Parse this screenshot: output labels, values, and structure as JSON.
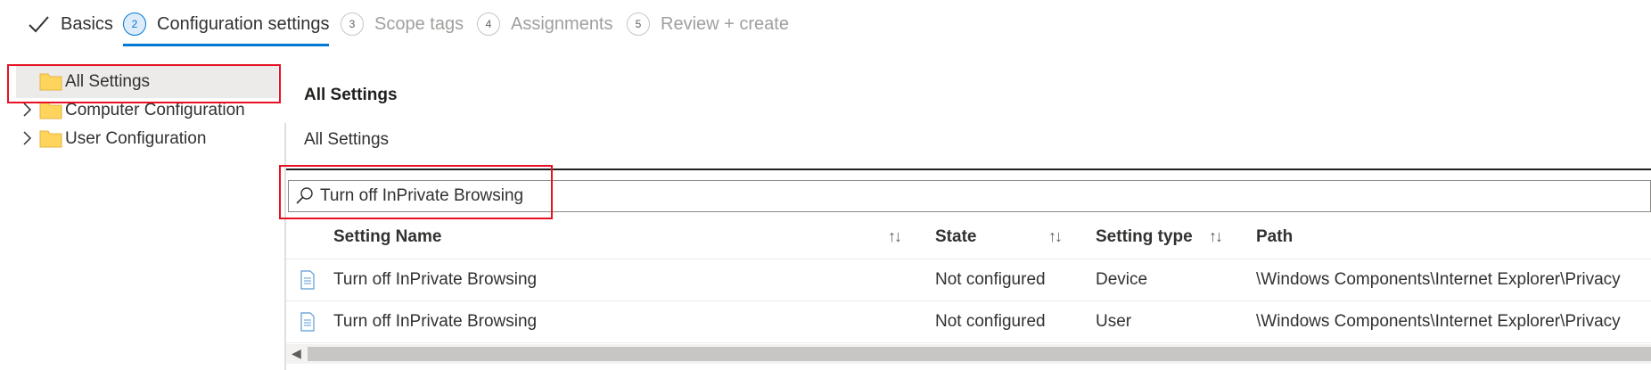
{
  "wizard": {
    "steps": [
      {
        "number": "",
        "label": "Basics",
        "state": "done"
      },
      {
        "number": "2",
        "label": "Configuration settings",
        "state": "active"
      },
      {
        "number": "3",
        "label": "Scope tags",
        "state": "pending"
      },
      {
        "number": "4",
        "label": "Assignments",
        "state": "pending"
      },
      {
        "number": "5",
        "label": "Review + create",
        "state": "pending"
      }
    ]
  },
  "tree": {
    "items": [
      {
        "label": "All Settings",
        "selected": true,
        "expandable": false
      },
      {
        "label": "Computer Configuration",
        "selected": false,
        "expandable": true
      },
      {
        "label": "User Configuration",
        "selected": false,
        "expandable": true
      }
    ]
  },
  "panel": {
    "title": "All Settings",
    "breadcrumb": "All Settings"
  },
  "search": {
    "value": "Turn off InPrivate Browsing"
  },
  "table": {
    "columns": [
      "Setting Name",
      "State",
      "Setting type",
      "Path"
    ],
    "rows": [
      {
        "name": "Turn off InPrivate Browsing",
        "state": "Not configured",
        "type": "Device",
        "path": "\\Windows Components\\Internet Explorer\\Privacy"
      },
      {
        "name": "Turn off InPrivate Browsing",
        "state": "Not configured",
        "type": "User",
        "path": "\\Windows Components\\Internet Explorer\\Privacy"
      }
    ]
  },
  "icons": {
    "folder": "folder-icon",
    "document": "document-icon",
    "search": "search-icon",
    "chevron": "chevron-right-icon",
    "check": "check-icon"
  },
  "colors": {
    "accent": "#0078d4",
    "highlight_box": "#e81123",
    "folder": "#ffd45c"
  }
}
